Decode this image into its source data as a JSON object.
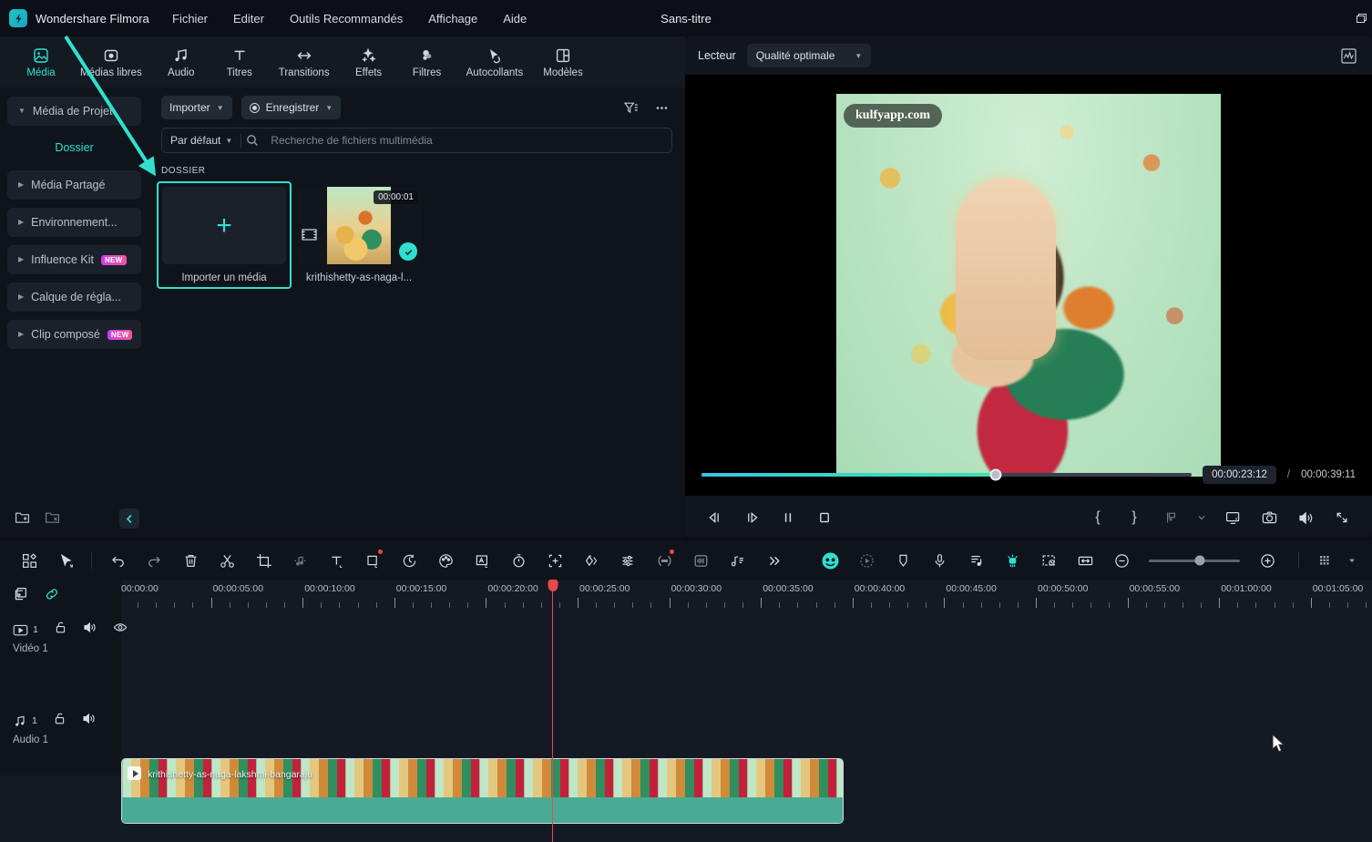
{
  "app": {
    "brand": "Wondershare Filmora",
    "document_title": "Sans-titre",
    "accent": "#2fe0d0",
    "playhead_color": "#e8484e"
  },
  "menubar": {
    "items": [
      {
        "label": "Fichier"
      },
      {
        "label": "Editer"
      },
      {
        "label": "Outils Recommandés"
      },
      {
        "label": "Affichage"
      },
      {
        "label": "Aide"
      }
    ]
  },
  "tool_tabs": [
    {
      "label": "Média",
      "icon": "media-icon",
      "active": true
    },
    {
      "label": "Médias libres",
      "icon": "stock-media-icon",
      "active": false
    },
    {
      "label": "Audio",
      "icon": "audio-icon",
      "active": false
    },
    {
      "label": "Titres",
      "icon": "titles-icon",
      "active": false
    },
    {
      "label": "Transitions",
      "icon": "transitions-icon",
      "active": false
    },
    {
      "label": "Effets",
      "icon": "effects-icon",
      "active": false
    },
    {
      "label": "Filtres",
      "icon": "filters-icon",
      "active": false
    },
    {
      "label": "Autocollants",
      "icon": "stickers-icon",
      "active": false
    },
    {
      "label": "Modèles",
      "icon": "templates-icon",
      "active": false
    }
  ],
  "sidebar": {
    "items": [
      {
        "label": "Média de Projet",
        "expanded": true,
        "badge": ""
      },
      {
        "label": "Média Partagé",
        "expanded": false,
        "badge": ""
      },
      {
        "label": "Environnement...",
        "expanded": false,
        "badge": ""
      },
      {
        "label": "Influence Kit",
        "expanded": false,
        "badge": "NEW"
      },
      {
        "label": "Calque de régla...",
        "expanded": false,
        "badge": ""
      },
      {
        "label": "Clip composé",
        "expanded": false,
        "badge": "NEW"
      }
    ],
    "sub_item": "Dossier",
    "footer": {
      "new_folder": "new-folder-icon",
      "delete_folder": "delete-folder-icon",
      "collapse": "collapse-panel-icon"
    }
  },
  "media_panel": {
    "import_button": "Importer",
    "record_button": "Enregistrer",
    "filter_icon": "filter-icon",
    "more_icon": "more-options-icon",
    "sort_label": "Par défaut",
    "search_placeholder": "Recherche de fichiers multimédia",
    "search_value": "",
    "section_label": "DOSSIER",
    "items": [
      {
        "type": "import",
        "label": "Importer un média",
        "selected": true
      },
      {
        "type": "clip",
        "label": "krithishetty-as-naga-l...",
        "duration": "00:00:01",
        "checked": true,
        "selected": false
      }
    ]
  },
  "preview": {
    "title": "Lecteur",
    "quality": "Qualité optimale",
    "analytics_icon": "waveform-icon",
    "watermark": "kulfyapp.com",
    "current_time": "00:00:23:12",
    "separator": "/",
    "total_time": "00:00:39:11",
    "progress_percent": 60,
    "controls": [
      {
        "name": "prev-frame-button",
        "icon": "step-back-icon"
      },
      {
        "name": "next-frame-button",
        "icon": "step-forward-icon"
      },
      {
        "name": "pause-button",
        "icon": "pause-icon"
      },
      {
        "name": "stop-button",
        "icon": "stop-icon"
      }
    ],
    "right_controls": [
      {
        "name": "mark-in-button",
        "icon": "brace-open-icon",
        "glyph": "{"
      },
      {
        "name": "mark-out-button",
        "icon": "brace-close-icon",
        "glyph": "}"
      },
      {
        "name": "add-marker-button",
        "icon": "add-marker-icon"
      },
      {
        "name": "marker-dropdown",
        "icon": "chevron-down-icon"
      },
      {
        "name": "display-mode-button",
        "icon": "monitor-icon"
      },
      {
        "name": "snapshot-button",
        "icon": "camera-icon"
      },
      {
        "name": "volume-button",
        "icon": "speaker-icon"
      },
      {
        "name": "fullscreen-button",
        "icon": "expand-icon"
      }
    ]
  },
  "timeline": {
    "toolbar_left": [
      {
        "name": "layout-button",
        "icon": "grid-layout-icon"
      },
      {
        "name": "select-tool",
        "icon": "cursor-icon"
      },
      {
        "name": "undo-button",
        "icon": "undo-icon"
      },
      {
        "name": "redo-button",
        "icon": "redo-icon"
      },
      {
        "name": "delete-button",
        "icon": "trash-icon"
      },
      {
        "name": "split-button",
        "icon": "scissors-icon"
      },
      {
        "name": "crop-button",
        "icon": "crop-icon"
      },
      {
        "name": "audio-detach-button",
        "icon": "audio-split-icon"
      },
      {
        "name": "text-button",
        "icon": "text-icon"
      },
      {
        "name": "keyframe-button",
        "icon": "square-keyframe-icon",
        "badge": true
      },
      {
        "name": "speed-button",
        "icon": "speed-clock-icon"
      },
      {
        "name": "color-button",
        "icon": "color-palette-icon"
      },
      {
        "name": "mask-button",
        "icon": "mask-icon"
      },
      {
        "name": "timer-button",
        "icon": "stopwatch-icon"
      },
      {
        "name": "add-keyframe-button",
        "icon": "add-frame-icon"
      },
      {
        "name": "animation-button",
        "icon": "animation-icon"
      },
      {
        "name": "adjust-button",
        "icon": "sliders-icon"
      },
      {
        "name": "ai-tools-button",
        "icon": "ai-dots-icon",
        "badge": true
      },
      {
        "name": "audio-wave-button",
        "icon": "audio-wave-icon"
      },
      {
        "name": "audio-mix-button",
        "icon": "audio-mix-icon"
      },
      {
        "name": "more-tools-button",
        "icon": "chevrons-right-icon"
      }
    ],
    "toolbar_right": [
      {
        "name": "ai-mask-button",
        "icon": "smart-circle-icon",
        "active": true
      },
      {
        "name": "motion-tracking-button",
        "icon": "motion-track-icon"
      },
      {
        "name": "marker-button",
        "icon": "marker-shield-icon"
      },
      {
        "name": "voiceover-button",
        "icon": "microphone-icon"
      },
      {
        "name": "auto-beat-button",
        "icon": "beat-sync-icon"
      },
      {
        "name": "green-screen-button",
        "icon": "green-screen-icon",
        "active": true
      },
      {
        "name": "screen-record-button",
        "icon": "screen-record-icon"
      },
      {
        "name": "fit-timeline-button",
        "icon": "fit-width-icon"
      },
      {
        "name": "zoom-out-button",
        "icon": "minus-circle-icon"
      },
      {
        "name": "zoom-in-button",
        "icon": "plus-circle-icon"
      },
      {
        "name": "render-preview-button",
        "icon": "render-grid-icon"
      },
      {
        "name": "render-dropdown",
        "icon": "chevron-down-icon"
      }
    ],
    "header_icons": [
      {
        "name": "add-track-button",
        "icon": "add-track-icon"
      },
      {
        "name": "link-button",
        "icon": "link-icon"
      }
    ],
    "ruler": {
      "labels": [
        "00:00:00",
        "00:00:05:00",
        "00:00:10:00",
        "00:00:15:00",
        "00:00:20:00",
        "00:00:25:00",
        "00:00:30:00",
        "00:00:35:00",
        "00:00:40:00",
        "00:00:45:00",
        "00:00:50:00",
        "00:00:55:00",
        "00:01:00:00",
        "00:01:05:00"
      ],
      "playhead_label": "00:00:23:12"
    },
    "tracks": [
      {
        "name": "Vidéo 1",
        "number": "1",
        "type": "video",
        "icons": [
          "video-track-icon",
          "lock-icon",
          "mute-icon",
          "eye-icon"
        ],
        "clips": [
          {
            "title": "krithishetty-as-naga-lakshmi-bangaraju",
            "selected": true
          }
        ]
      },
      {
        "name": "Audio 1",
        "number": "1",
        "type": "audio",
        "icons": [
          "audio-track-icon",
          "lock-icon",
          "mute-icon"
        ],
        "clips": []
      }
    ]
  },
  "annotation": {
    "arrow_color": "#2fe0d0",
    "highlight_color": "#2fe0d0"
  }
}
